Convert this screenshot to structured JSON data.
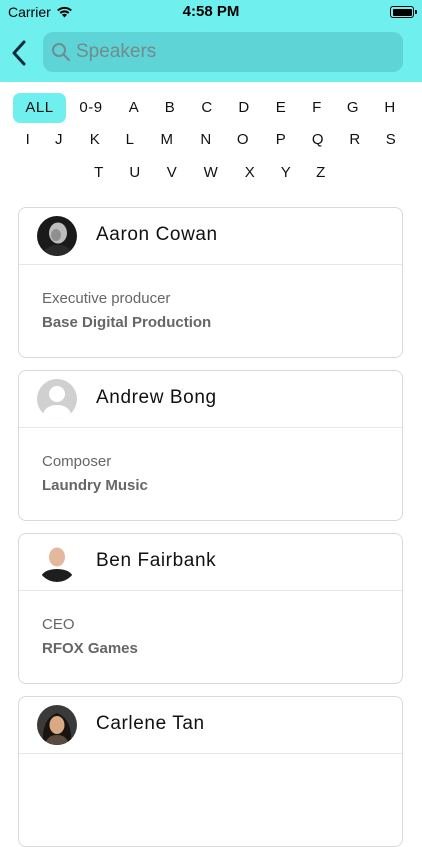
{
  "status_bar": {
    "carrier": "Carrier",
    "time": "4:58 PM"
  },
  "search": {
    "placeholder": "Speakers",
    "value": ""
  },
  "colors": {
    "accent": "#6fefee",
    "search_bg": "#5fd4d6"
  },
  "alphabet": {
    "row1": [
      "ALL",
      "0-9",
      "A",
      "B",
      "C",
      "D",
      "E",
      "F",
      "G",
      "H"
    ],
    "row2": [
      "I",
      "J",
      "K",
      "L",
      "M",
      "N",
      "O",
      "P",
      "Q",
      "R",
      "S"
    ],
    "row3": [
      "T",
      "U",
      "V",
      "W",
      "X",
      "Y",
      "Z"
    ],
    "selected": "ALL"
  },
  "speakers": [
    {
      "name": "Aaron Cowan",
      "role": "Executive producer",
      "company": "Base Digital Production",
      "avatar": "photo-avatar"
    },
    {
      "name": "Andrew Bong",
      "role": "Composer",
      "company": "Laundry Music",
      "avatar": "placeholder-avatar"
    },
    {
      "name": "Ben Fairbank",
      "role": "CEO",
      "company": "RFOX Games",
      "avatar": "photo-avatar"
    },
    {
      "name": "Carlene Tan",
      "role": "",
      "company": "",
      "avatar": "photo-avatar"
    }
  ]
}
